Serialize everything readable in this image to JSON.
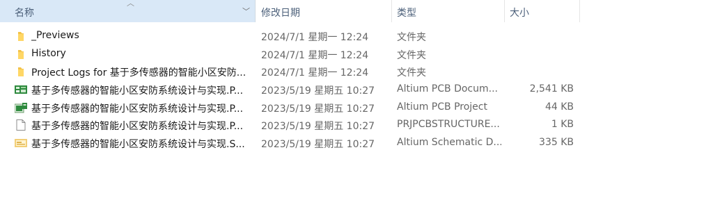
{
  "columns": {
    "name": "名称",
    "date": "修改日期",
    "type": "类型",
    "size": "大小"
  },
  "files": [
    {
      "name": "_Previews",
      "date": "2024/7/1 星期一 12:24",
      "type": "文件夹",
      "size": "",
      "icon": "folder-icon"
    },
    {
      "name": "History",
      "date": "2024/7/1 星期一 12:24",
      "type": "文件夹",
      "size": "",
      "icon": "folder-icon"
    },
    {
      "name": "Project Logs for 基于多传感器的智能小区安防...",
      "date": "2024/7/1 星期一 12:24",
      "type": "文件夹",
      "size": "",
      "icon": "folder-icon"
    },
    {
      "name": "基于多传感器的智能小区安防系统设计与实现.P...",
      "date": "2023/5/19 星期五 10:27",
      "type": "Altium PCB Docum...",
      "size": "2,541 KB",
      "icon": "pcb-document-icon"
    },
    {
      "name": "基于多传感器的智能小区安防系统设计与实现.P...",
      "date": "2023/5/19 星期五 10:27",
      "type": "Altium PCB Project",
      "size": "44 KB",
      "icon": "pcb-project-icon"
    },
    {
      "name": "基于多传感器的智能小区安防系统设计与实现.P...",
      "date": "2023/5/19 星期五 10:27",
      "type": "PRJPCBSTRUCTURE...",
      "size": "1 KB",
      "icon": "blank-file-icon"
    },
    {
      "name": "基于多传感器的智能小区安防系统设计与实现.S...",
      "date": "2023/5/19 星期五 10:27",
      "type": "Altium Schematic D...",
      "size": "335 KB",
      "icon": "schematic-document-icon"
    }
  ]
}
